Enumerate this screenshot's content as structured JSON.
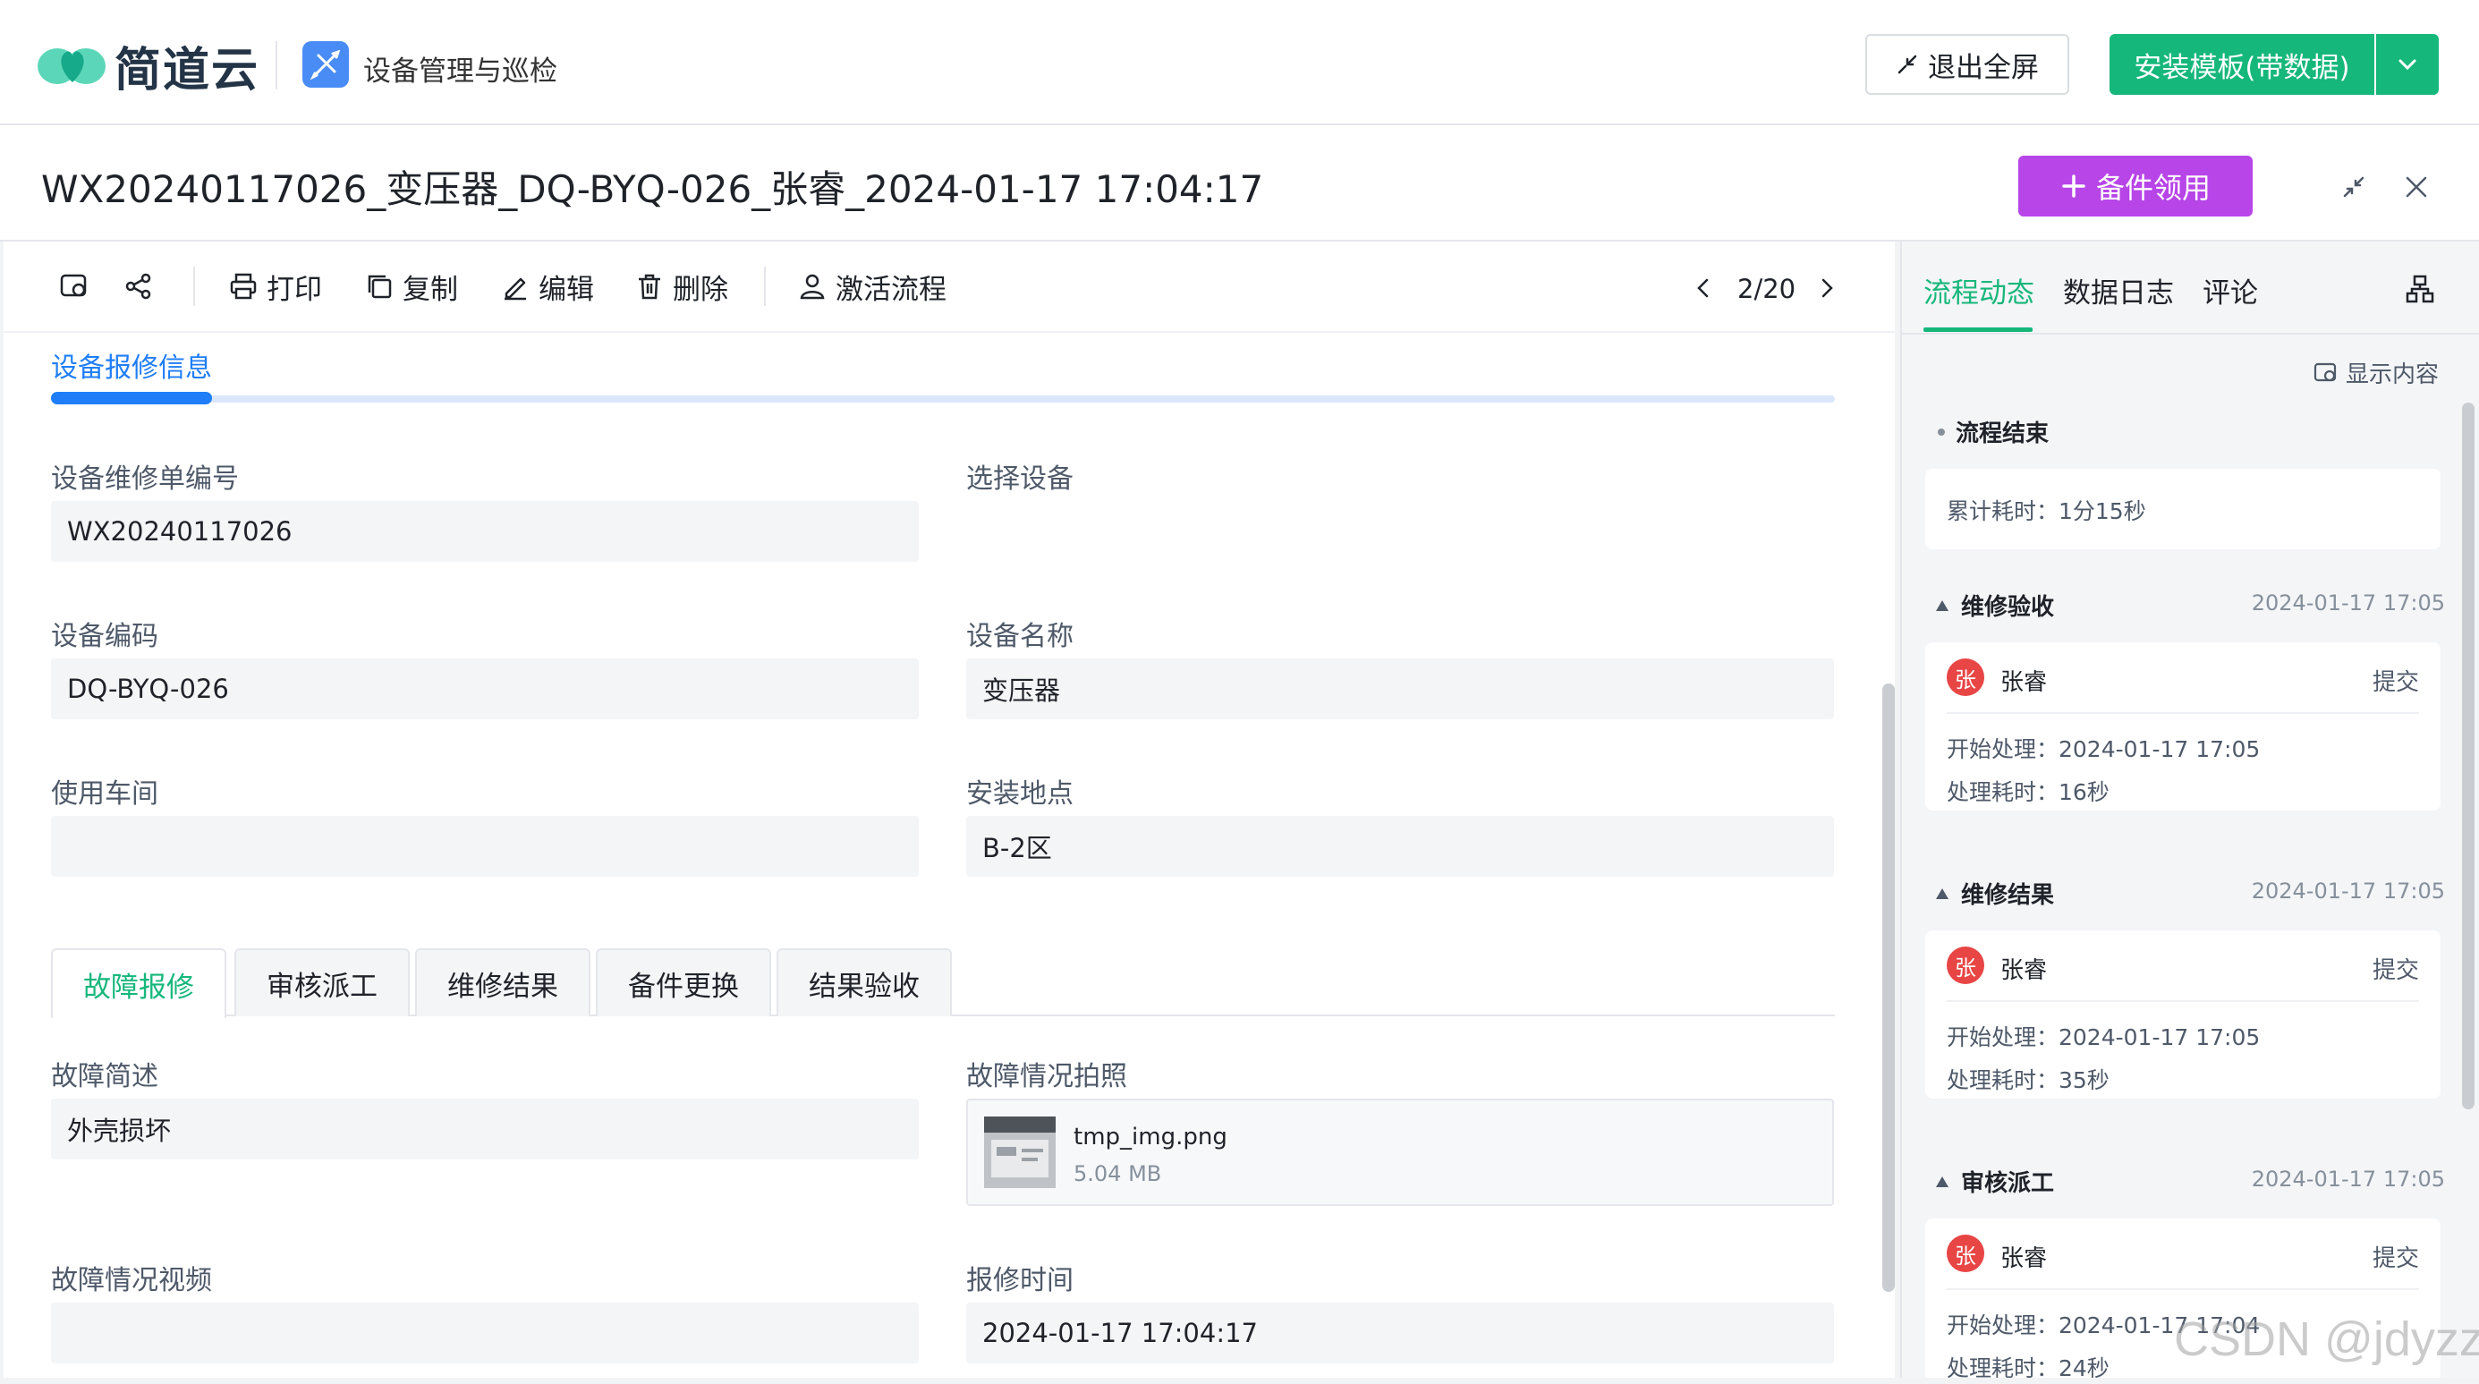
{
  "header": {
    "brand": "简道云",
    "app_name": "设备管理与巡检",
    "exit_fullscreen": "退出全屏",
    "install_template": "安装模板(带数据)"
  },
  "record": {
    "title": "WX20240117026_变压器_DQ-BYQ-026_张睿_2024-01-17 17:04:17",
    "spare_button": "备件领用"
  },
  "toolbar": {
    "print": "打印",
    "copy": "复制",
    "edit": "编辑",
    "delete": "删除",
    "activate": "激活流程",
    "pager": "2/20"
  },
  "form": {
    "section_title": "设备报修信息",
    "fields": {
      "repair_no_label": "设备维修单编号",
      "repair_no": "WX20240117026",
      "select_device_label": "选择设备",
      "device_code_label": "设备编码",
      "device_code": "DQ-BYQ-026",
      "device_name_label": "设备名称",
      "device_name": "变压器",
      "workshop_label": "使用车间",
      "workshop": "",
      "location_label": "安装地点",
      "location": "B-2区"
    },
    "subtabs": [
      "故障报修",
      "审核派工",
      "维修结果",
      "备件更换",
      "结果验收"
    ],
    "fault": {
      "desc_label": "故障简述",
      "desc": "外壳损坏",
      "photo_label": "故障情况拍照",
      "photo_file": "tmp_img.png",
      "photo_size": "5.04 MB",
      "video_label": "故障情况视频",
      "video": "",
      "time_label": "报修时间",
      "time": "2024-01-17 17:04:17"
    }
  },
  "side": {
    "tabs": [
      "流程动态",
      "数据日志",
      "评论"
    ],
    "show_content": "显示内容",
    "end_title": "流程结束",
    "end_total": "累计耗时：1分15秒",
    "nodes": [
      {
        "title": "维修验收",
        "time": "2024-01-17 17:05",
        "avatar": "张",
        "user": "张睿",
        "action": "提交",
        "start": "开始处理：2024-01-17 17:05",
        "cost": "处理耗时：16秒"
      },
      {
        "title": "维修结果",
        "time": "2024-01-17 17:05",
        "avatar": "张",
        "user": "张睿",
        "action": "提交",
        "start": "开始处理：2024-01-17 17:05",
        "cost": "处理耗时：35秒"
      },
      {
        "title": "审核派工",
        "time": "2024-01-17 17:05",
        "avatar": "张",
        "user": "张睿",
        "action": "提交",
        "start": "开始处理：2024-01-17 17:04",
        "cost": "处理耗时：24秒"
      }
    ]
  },
  "watermark": "CSDN @jdyzzy",
  "colors": {
    "primary_green": "#16b77b",
    "link_blue": "#1f7ef7",
    "purple": "#b745e8",
    "avatar_red": "#e84545"
  }
}
